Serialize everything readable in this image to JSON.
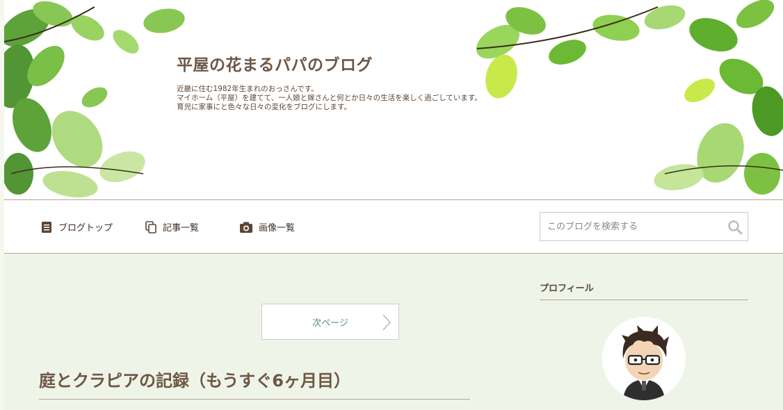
{
  "header": {
    "blog_title": "平屋の花まるパパのブログ",
    "description": "近畿に住む1982年生まれのおっさんです。\nマイホーム（平屋）を建てて、一人娘と嫁さんと何とか日々の生活を楽しく過ごしています。\n育児に家事にと色々な日々の変化をブログにします。"
  },
  "nav": {
    "items": [
      {
        "label": "ブログトップ",
        "icon": "document-icon"
      },
      {
        "label": "記事一覧",
        "icon": "copy-icon"
      },
      {
        "label": "画像一覧",
        "icon": "camera-icon"
      }
    ],
    "search_placeholder": "このブログを検索する"
  },
  "main": {
    "next_page_label": "次ページ",
    "post_title": "庭とクラピアの記録（もうすぐ6ヶ月目）"
  },
  "sidebar": {
    "profile_heading": "プロフィール"
  },
  "colors": {
    "background": "#eef4e8",
    "title_brown": "#6e5644",
    "link_green": "#4f8a6b",
    "rule": "#b3a596"
  }
}
